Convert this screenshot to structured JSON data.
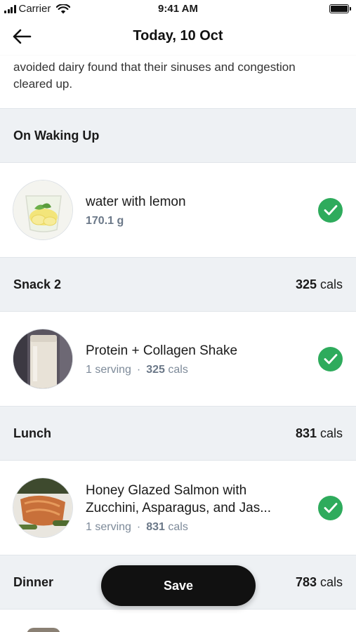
{
  "status_bar": {
    "carrier": "Carrier",
    "time": "9:41 AM"
  },
  "header": {
    "title": "Today, 10 Oct",
    "back_icon": "arrow-left-icon"
  },
  "intro": {
    "line1": "avoided dairy found that their sinuses and congestion",
    "line2": "cleared up."
  },
  "sections": [
    {
      "title": "On Waking Up",
      "cals": "",
      "cals_unit": "",
      "item": {
        "name_line1": "water with lemon",
        "name_line2": "",
        "amount": "170.1 g",
        "serving": "",
        "item_cals": "",
        "item_cals_unit": "",
        "checked": true
      }
    },
    {
      "title": "Snack 2",
      "cals": "325",
      "cals_unit": " cals",
      "item": {
        "name_line1": "Protein + Collagen Shake",
        "name_line2": "",
        "amount": "",
        "serving": "1 serving",
        "item_cals": "325",
        "item_cals_unit": " cals",
        "checked": true
      }
    },
    {
      "title": "Lunch",
      "cals": "831",
      "cals_unit": " cals",
      "item": {
        "name_line1": "Honey Glazed Salmon with",
        "name_line2": "Zucchini, Asparagus, and Jas...",
        "amount": "",
        "serving": "1 serving",
        "item_cals": "831",
        "item_cals_unit": " cals",
        "checked": true
      }
    },
    {
      "title": "Dinner",
      "cals": "783",
      "cals_unit": " cals"
    }
  ],
  "save_button": {
    "label": "Save"
  },
  "colors": {
    "accent_green": "#2eab5c",
    "section_bg": "#eef1f4",
    "button_bg": "#111111"
  }
}
